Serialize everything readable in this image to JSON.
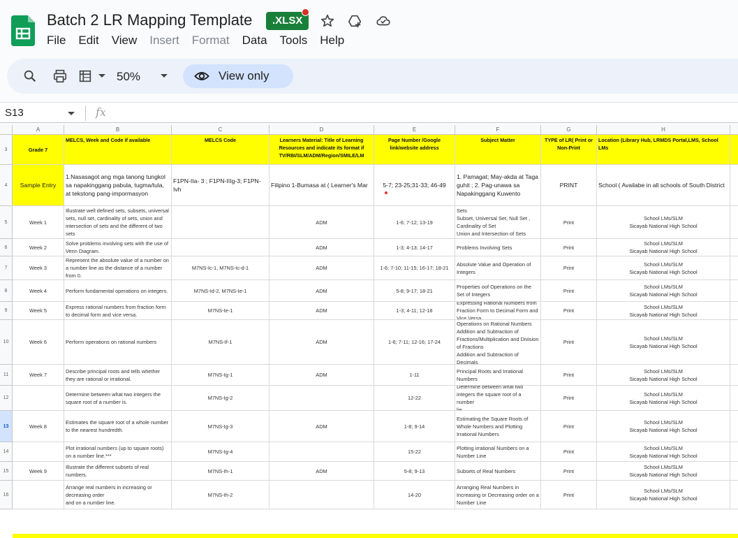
{
  "app": {
    "title": "Batch 2 LR Mapping Template",
    "badge": ".XLSX",
    "menus": [
      {
        "label": "File",
        "disabled": false
      },
      {
        "label": "Edit",
        "disabled": false
      },
      {
        "label": "View",
        "disabled": false
      },
      {
        "label": "Insert",
        "disabled": true
      },
      {
        "label": "Format",
        "disabled": true
      },
      {
        "label": "Data",
        "disabled": false
      },
      {
        "label": "Tools",
        "disabled": false
      },
      {
        "label": "Help",
        "disabled": false
      }
    ],
    "colors": {
      "brand_green": "#188038",
      "view_only_bg": "#d3e3fd",
      "highlight_yellow": "#ffff00"
    }
  },
  "toolbar": {
    "zoom": "50%",
    "view_only_label": "View only",
    "icons": [
      "search-icon",
      "print-icon",
      "format-table-icon",
      "eye-icon"
    ]
  },
  "formula_bar": {
    "cell_ref": "S13",
    "fx_label": "fx"
  },
  "sheet": {
    "columns": [
      "A",
      "B",
      "C",
      "D",
      "E",
      "F",
      "G",
      "H"
    ],
    "row_numbers": [
      "3",
      "4",
      "5",
      "6",
      "7",
      "8",
      "9",
      "10",
      "11",
      "12",
      "13",
      "14",
      "15",
      "16"
    ],
    "active_row": "13",
    "header": {
      "a": "Grade 7",
      "b": "MELCS,  Week and  Code if available",
      "c": "MELCS Code",
      "d": "Learners Material: Title of Learning Resources and indicate its format  if TV/RBI/SLM/ADM/Region/SMILE/LM",
      "e": "Page Number /Google link/website address",
      "f": "Subject Matter",
      "g": "TYPE of LR( Print or Non-Print",
      "h": "Location (Library Hub, LRMDS Portal,LMS, School LMs"
    },
    "sample": {
      "a": "Sample Entry",
      "b": "1.Nasasagot ang mga tanong tungkol sa napakinggang pabula, tugma/tula, at tekstong pang-impormasyon",
      "c": "F1PN-IIa- 3 ; F1PN-IIIg-3; F1PN-Ivh",
      "d": "Filipino 1-Bumasa at  ( Learner's Mar",
      "e": "5-7; 23-25;31-33; 46-49",
      "f": "1. Pamagat; May-akda at Taga guhit ; 2. Pag-unawa sa Napakinggang Kuwento",
      "g": "PRINT",
      "h": "School ( Availabe in all schools of South District"
    },
    "rows": [
      {
        "a": "Week 1",
        "b": "Illustrate well defined sets, subsets, universal sets, null set, cardinality of sets, union and intersection of sets and the different of two sets",
        "c": "",
        "d": "ADM",
        "e": "1-6; 7-12; 13-19",
        "f": "Sets\nSubset, Universal Set, Null Set , Cardinality of Set\nUnion and Intersection of Sets",
        "g": "Print",
        "h": "School LMs/SLM\nSicayab National High School"
      },
      {
        "a": "Week 2",
        "b": "Solve problems involving sets with the use of Venn Diagram.",
        "c": "",
        "d": "ADM",
        "e": "1-3; 4-13; 14-17",
        "f": "Problems Involving Sets",
        "g": "Print",
        "h": "School LMs/SLM\nSicayab National High School"
      },
      {
        "a": "Week 3",
        "b": "Represent the absolute value of a number on a number line as the distance of a number from 0.",
        "c": "M7NS-Ic-1, M7NS-Ic-d-1",
        "d": "ADM",
        "e": "1-6; 7-10; 11-15; 16-17; 18-21",
        "f": "Absolute Value and Operation of Integers",
        "g": "Print",
        "h": "School LMs/SLM\nSicayab National High School"
      },
      {
        "a": "Week 4",
        "b": "Perform fundamental operations on integers.",
        "c": "M7NS-Id-2,  M7NS-Ie-1",
        "d": "ADM",
        "e": "5-8; 9-17; 18-21",
        "f": "Properties oof Operations on the Set of Integers",
        "g": "Print",
        "h": "School LMs/SLM\nSicayab National High School"
      },
      {
        "a": "Week 5",
        "b": "Express rational numbers from fraction form to decimal form and vice versa.",
        "c": "M7NS-Ie-1",
        "d": "ADM",
        "e": "1-3; 4-11; 12-18",
        "f": "Expressing Rational Numbers from Fraction Form to Decimal Form and Vice Versa",
        "g": "Print",
        "h": "School LMs/SLM\nSicayab National High School"
      },
      {
        "a": "Week 6",
        "b": "Perform operations on rational numbers",
        "c": "M7NS-If-1",
        "d": "ADM",
        "e": "1-6; 7-11; 12-16; 17-24",
        "f": "Operations on Rational Numbers\nAddition and Subtraction of Fractions/Multiplication and Division of Fractions\nAddition and Subtraction of Decimals\nMultiplication and Division of Decimals",
        "g": "Print",
        "h": "School LMs/SLM\nSicayab National High School"
      },
      {
        "a": "Week 7",
        "b": "Describe principal roots and tells whether they are rational or irrational.",
        "c": "M7NS-Ig-1",
        "d": "ADM",
        "e": "1-11",
        "f": "Principal Roots and Irrational Numbers",
        "g": "Print",
        "h": "School LMs/SLM\nSicayab National High School"
      },
      {
        "a": "",
        "b": "Determine between what two integers the square root of a number is.",
        "c": "M7NS-Ig-2",
        "d": "",
        "e": "12-22",
        "f": "Determine between what two integers the square root of a number\n lie.",
        "g": "Print",
        "h": "School LMs/SLM\nSicayab National High School"
      },
      {
        "a": "Week 8",
        "b": "Estimates the square root of a whole number to the nearest hundredth.",
        "c": "M7NS-Ig-3",
        "d": "ADM",
        "e": "1-8; 9-14",
        "f": "Estimating the Square Roots of Whole Numbers and Plotting Irrational Numbers",
        "g": "Print",
        "h": "School LMs/SLM\nSicayab National High School"
      },
      {
        "a": "",
        "b": "Plot irrational numbers (up to square roots) on a number line.***",
        "c": "M7NS-Ig-4",
        "d": "",
        "e": "15-22",
        "f": "Plotting irrational Numbers on a Number Line",
        "g": "Print",
        "h": "School LMs/SLM\nSicayab National High School"
      },
      {
        "a": "Week 9",
        "b": "Illustrate the different subsets of real numbers.",
        "c": "M7NS-Ih-1",
        "d": "ADM",
        "e": "5-8; 9-13",
        "f": "Subsets of Real Numbers",
        "g": "Print",
        "h": "School LMs/SLM\nSicayab National High School"
      },
      {
        "a": "",
        "b": "Arrange real numbers in increasing or decreasing order\nand on a number line.",
        "c": "M7NS-Ih-2",
        "d": "",
        "e": "14-20",
        "f": "Arranging Real Numbers in Increasing or Decreasing order on a Number Line",
        "g": "Print",
        "h": "School LMs/SLM\nSicayab National High School"
      }
    ]
  }
}
